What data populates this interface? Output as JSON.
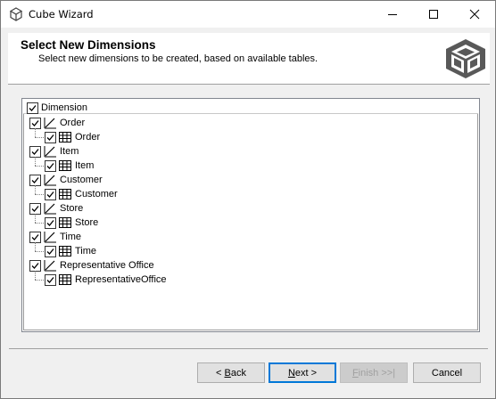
{
  "window": {
    "title": "Cube Wizard",
    "icon": "cube-icon"
  },
  "header": {
    "title": "Select New Dimensions",
    "subtitle": "Select new dimensions to be created, based on available tables.",
    "logo": "cube-logo-icon"
  },
  "tree": {
    "column_header": "Dimension",
    "items": [
      {
        "label": "Order",
        "checked": true,
        "icon": "dimension-icon",
        "child": {
          "label": "Order",
          "checked": true,
          "icon": "table-icon"
        }
      },
      {
        "label": "Item",
        "checked": true,
        "icon": "dimension-icon",
        "child": {
          "label": "Item",
          "checked": true,
          "icon": "table-icon"
        }
      },
      {
        "label": "Customer",
        "checked": true,
        "icon": "dimension-icon",
        "child": {
          "label": "Customer",
          "checked": true,
          "icon": "table-icon"
        }
      },
      {
        "label": "Store",
        "checked": true,
        "icon": "dimension-icon",
        "child": {
          "label": "Store",
          "checked": true,
          "icon": "table-icon"
        }
      },
      {
        "label": "Time",
        "checked": true,
        "icon": "dimension-icon",
        "child": {
          "label": "Time",
          "checked": true,
          "icon": "table-icon"
        }
      },
      {
        "label": "Representative Office",
        "checked": true,
        "icon": "dimension-icon",
        "child": {
          "label": "RepresentativeOffice",
          "checked": true,
          "icon": "table-icon"
        }
      }
    ]
  },
  "buttons": {
    "back": {
      "prefix": "< ",
      "mnemonic": "B",
      "rest": "ack"
    },
    "next": {
      "mnemonic": "N",
      "rest": "ext >"
    },
    "finish": {
      "mnemonic": "F",
      "rest": "inish >>|",
      "enabled": false
    },
    "cancel": {
      "label": "Cancel"
    }
  },
  "colors": {
    "accent": "#0078d7",
    "window_bg": "#f0f0f0",
    "panel_bg": "#ffffff"
  }
}
